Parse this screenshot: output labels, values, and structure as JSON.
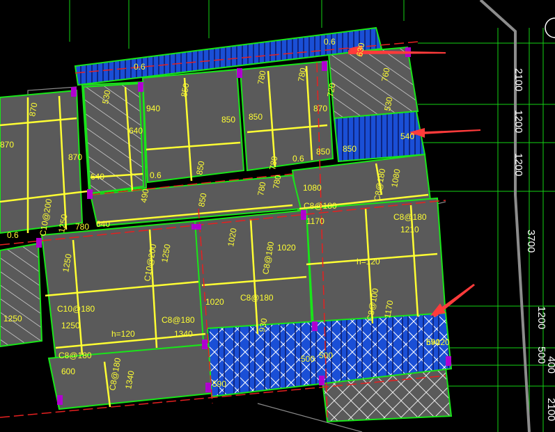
{
  "colors": {
    "background": "#000000",
    "slab_fill": "#5a5a5a",
    "blue_slab": "#1a4fd6",
    "rebar_yellow": "#ffff33",
    "wall_green": "#19e619",
    "grid_green": "#14d414",
    "beam_red": "#e62020",
    "column_magenta": "#b000d0",
    "arrow_red": "#ff3b3b",
    "dim_text": "#ffffff"
  },
  "dimensions_right": [
    "2100",
    "1200",
    "1200",
    "3700",
    "1200",
    "500",
    "400",
    "2100"
  ],
  "labels": {
    "top_strip": [
      "0.6",
      "0.6",
      "630",
      "720",
      "760",
      "530"
    ],
    "room1": [
      "870",
      "870",
      "870"
    ],
    "room2": [
      "530",
      "640",
      "640",
      "490"
    ],
    "room3": [
      "940",
      "850",
      "850",
      "850",
      "850"
    ],
    "room4": [
      "780",
      "780",
      "780",
      "850",
      "870",
      "850",
      "850"
    ],
    "room5": [
      "0.6",
      "780",
      "780"
    ],
    "right_upper": [
      "540",
      "1080",
      "C8@180",
      "1080",
      "C8@180",
      "1170",
      "C8@180",
      "1210"
    ],
    "center_mid": [
      "1020",
      "C8@180",
      "1020",
      "C8@180",
      "1020",
      "930"
    ],
    "left_lower": [
      "C10@200",
      "1250",
      "1250",
      "C10@200",
      "1250",
      "C10@180",
      "1250",
      "h=120",
      "C8@180",
      "1340"
    ],
    "misc": [
      "0.6",
      "0.6",
      "780",
      "640",
      "C8@180",
      "600",
      "C8@180",
      "1340",
      "C8@100",
      "1170",
      "h=120",
      "590",
      "500",
      "500",
      "590",
      "1250"
    ]
  },
  "tags": {
    "h_right": "h=120",
    "h_left": "h=120",
    "nav_icon": "compass-icon"
  }
}
